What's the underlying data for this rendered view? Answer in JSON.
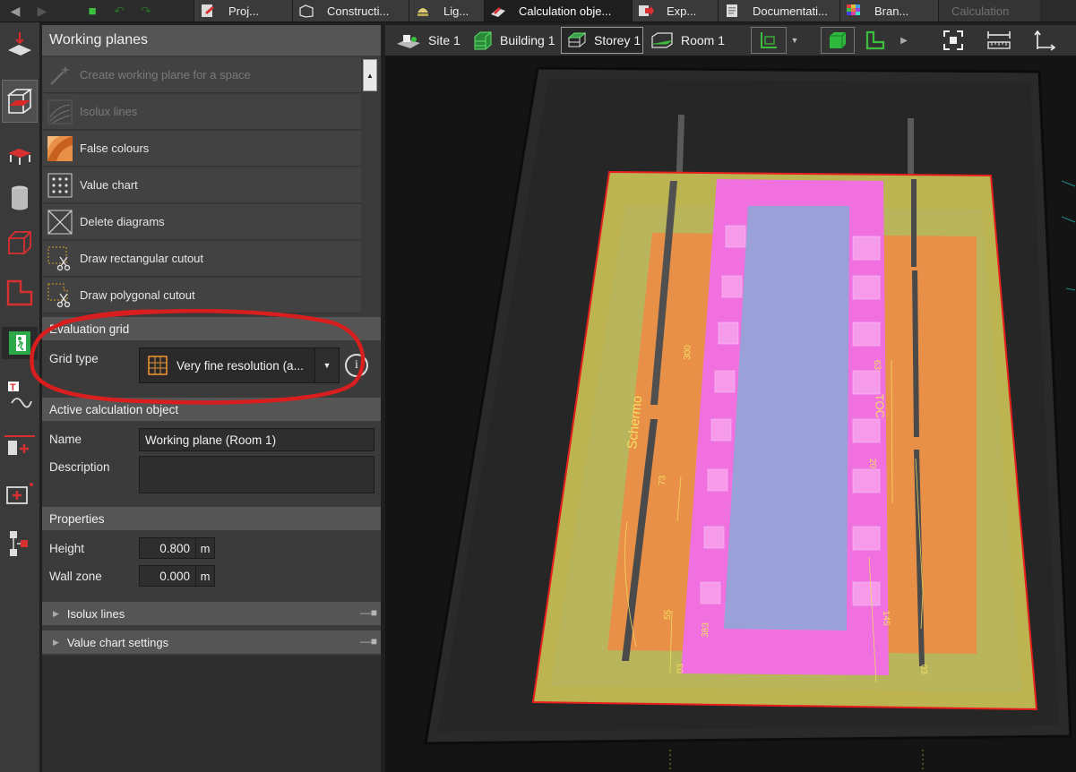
{
  "top_tabs": [
    {
      "label": "Proj...",
      "icon": "project-icon"
    },
    {
      "label": "Constructi...",
      "icon": "construction-icon"
    },
    {
      "label": "Lig...",
      "icon": "light-icon"
    },
    {
      "label": "Calculation obje...",
      "icon": "calculation-objects-icon",
      "active": true
    },
    {
      "label": "Exp...",
      "icon": "export-icon"
    },
    {
      "label": "Documentati...",
      "icon": "documentation-icon"
    },
    {
      "label": "Bran...",
      "icon": "branding-icon"
    },
    {
      "label": "Calculation",
      "icon": "",
      "disabled": true
    }
  ],
  "panel": {
    "title": "Working planes",
    "menu": [
      {
        "label": "Create working plane for a space",
        "icon": "magic-wand-icon",
        "disabled": true
      },
      {
        "label": "Isolux lines",
        "icon": "isolux-lines-icon",
        "disabled": true
      },
      {
        "label": "False colours",
        "icon": "false-colours-icon",
        "disabled": false
      },
      {
        "label": "Value chart",
        "icon": "value-chart-icon",
        "disabled": false
      },
      {
        "label": "Delete diagrams",
        "icon": "delete-diagrams-icon",
        "disabled": false
      },
      {
        "label": "Draw rectangular cutout",
        "icon": "rectangular-cutout-icon",
        "disabled": false
      },
      {
        "label": "Draw polygonal cutout",
        "icon": "polygonal-cutout-icon",
        "disabled": false
      }
    ],
    "evaluation_grid": {
      "title": "Evaluation grid",
      "grid_type_label": "Grid type",
      "grid_type_value": "Very fine resolution (a...",
      "info_label": "i"
    },
    "active_object": {
      "title": "Active calculation object",
      "name_label": "Name",
      "name_value": "Working plane (Room 1)",
      "description_label": "Description",
      "description_value": ""
    },
    "properties": {
      "title": "Properties",
      "height_label": "Height",
      "height_value": "0.800",
      "height_unit": "m",
      "wall_zone_label": "Wall zone",
      "wall_zone_value": "0.000",
      "wall_zone_unit": "m"
    },
    "collapsed_sections": [
      {
        "label": "Isolux lines"
      },
      {
        "label": "Value chart settings"
      }
    ]
  },
  "viewport_toolbar": {
    "breadcrumb": [
      {
        "label": "Site 1",
        "icon": "site-icon"
      },
      {
        "label": "Building 1",
        "icon": "building-icon"
      },
      {
        "label": "Storey 1",
        "icon": "storey-icon",
        "selected": true
      },
      {
        "label": "Room 1",
        "icon": "room-icon"
      }
    ],
    "icons": [
      "floor-plan-icon",
      "dropdown-arrow-icon",
      "green-cube-icon",
      "green-l-shape-icon",
      "more-arrow-icon",
      "fit-view-icon",
      "measure-icon",
      "axis-icon"
    ]
  },
  "scene_labels": {
    "schermo": "Schermo",
    "toc": "TOC",
    "values": [
      "300",
      "73",
      "55",
      "03",
      "383",
      "20",
      "63",
      "145",
      "03"
    ]
  },
  "colors": {
    "annotation_red": "#d81e1e",
    "false_colour_orange": "#e89048",
    "false_colour_magenta": "#f070e0",
    "false_colour_yellow": "#bcb450",
    "table_blue": "#9aa0d8"
  }
}
